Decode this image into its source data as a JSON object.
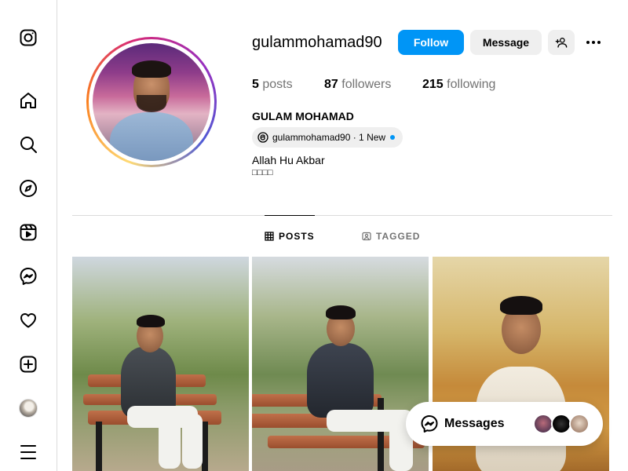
{
  "sidebar": {
    "items": [
      {
        "name": "instagram-logo"
      },
      {
        "name": "home",
        "icon": "home-icon"
      },
      {
        "name": "search",
        "icon": "search-icon"
      },
      {
        "name": "explore",
        "icon": "compass-icon"
      },
      {
        "name": "reels",
        "icon": "reels-icon"
      },
      {
        "name": "messages",
        "icon": "messenger-icon"
      },
      {
        "name": "notifications",
        "icon": "heart-icon"
      },
      {
        "name": "create",
        "icon": "plus-square-icon"
      },
      {
        "name": "profile",
        "icon": "avatar"
      },
      {
        "name": "more",
        "icon": "hamburger-icon"
      }
    ]
  },
  "profile": {
    "username": "gulammohamad90",
    "follow_label": "Follow",
    "message_label": "Message",
    "stats": {
      "posts_count": "5",
      "posts_label": "posts",
      "followers_count": "87",
      "followers_label": "followers",
      "following_count": "215",
      "following_label": "following"
    },
    "full_name": "GULAM MOHAMAD",
    "threads_text": "gulammohamad90 · 1 New",
    "bio_line1": "Allah Hu Akbar",
    "bio_line2": "□□□□"
  },
  "tabs": [
    {
      "label": "POSTS",
      "active": true
    },
    {
      "label": "TAGGED",
      "active": false
    }
  ],
  "messages_popup": {
    "label": "Messages"
  },
  "colors": {
    "accent": "#0095f6",
    "muted": "#737373",
    "border": "#dbdbdb",
    "button_bg": "#efefef"
  }
}
